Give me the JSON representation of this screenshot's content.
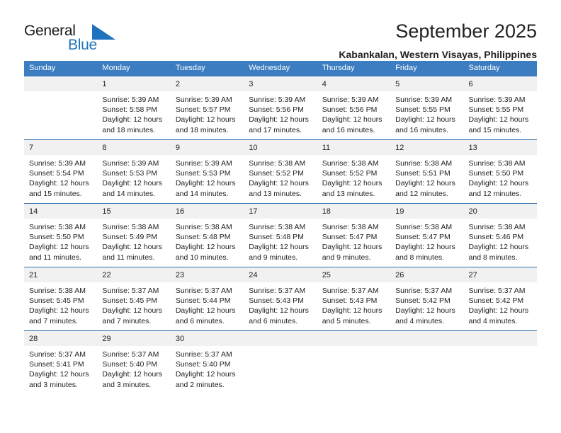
{
  "brand": {
    "name_part1": "General",
    "name_part2": "Blue",
    "flag_icon": "blue-triangle-flag-icon",
    "accent_color": "#1f72bd"
  },
  "header": {
    "title": "September 2025",
    "subtitle": "Kabankalan, Western Visayas, Philippines"
  },
  "theme": {
    "header_blue": "#3b7dc0",
    "daynum_band": "#f1f1f1",
    "separator": "#2f6fae"
  },
  "calendar": {
    "weekday_headers": [
      "Sunday",
      "Monday",
      "Tuesday",
      "Wednesday",
      "Thursday",
      "Friday",
      "Saturday"
    ],
    "weeks": [
      {
        "days": [
          {
            "num": "",
            "sunrise": "",
            "sunset": "",
            "daylight1": "",
            "daylight2": ""
          },
          {
            "num": "1",
            "sunrise": "Sunrise: 5:39 AM",
            "sunset": "Sunset: 5:58 PM",
            "daylight1": "Daylight: 12 hours",
            "daylight2": "and 18 minutes."
          },
          {
            "num": "2",
            "sunrise": "Sunrise: 5:39 AM",
            "sunset": "Sunset: 5:57 PM",
            "daylight1": "Daylight: 12 hours",
            "daylight2": "and 18 minutes."
          },
          {
            "num": "3",
            "sunrise": "Sunrise: 5:39 AM",
            "sunset": "Sunset: 5:56 PM",
            "daylight1": "Daylight: 12 hours",
            "daylight2": "and 17 minutes."
          },
          {
            "num": "4",
            "sunrise": "Sunrise: 5:39 AM",
            "sunset": "Sunset: 5:56 PM",
            "daylight1": "Daylight: 12 hours",
            "daylight2": "and 16 minutes."
          },
          {
            "num": "5",
            "sunrise": "Sunrise: 5:39 AM",
            "sunset": "Sunset: 5:55 PM",
            "daylight1": "Daylight: 12 hours",
            "daylight2": "and 16 minutes."
          },
          {
            "num": "6",
            "sunrise": "Sunrise: 5:39 AM",
            "sunset": "Sunset: 5:55 PM",
            "daylight1": "Daylight: 12 hours",
            "daylight2": "and 15 minutes."
          }
        ]
      },
      {
        "days": [
          {
            "num": "7",
            "sunrise": "Sunrise: 5:39 AM",
            "sunset": "Sunset: 5:54 PM",
            "daylight1": "Daylight: 12 hours",
            "daylight2": "and 15 minutes."
          },
          {
            "num": "8",
            "sunrise": "Sunrise: 5:39 AM",
            "sunset": "Sunset: 5:53 PM",
            "daylight1": "Daylight: 12 hours",
            "daylight2": "and 14 minutes."
          },
          {
            "num": "9",
            "sunrise": "Sunrise: 5:39 AM",
            "sunset": "Sunset: 5:53 PM",
            "daylight1": "Daylight: 12 hours",
            "daylight2": "and 14 minutes."
          },
          {
            "num": "10",
            "sunrise": "Sunrise: 5:38 AM",
            "sunset": "Sunset: 5:52 PM",
            "daylight1": "Daylight: 12 hours",
            "daylight2": "and 13 minutes."
          },
          {
            "num": "11",
            "sunrise": "Sunrise: 5:38 AM",
            "sunset": "Sunset: 5:52 PM",
            "daylight1": "Daylight: 12 hours",
            "daylight2": "and 13 minutes."
          },
          {
            "num": "12",
            "sunrise": "Sunrise: 5:38 AM",
            "sunset": "Sunset: 5:51 PM",
            "daylight1": "Daylight: 12 hours",
            "daylight2": "and 12 minutes."
          },
          {
            "num": "13",
            "sunrise": "Sunrise: 5:38 AM",
            "sunset": "Sunset: 5:50 PM",
            "daylight1": "Daylight: 12 hours",
            "daylight2": "and 12 minutes."
          }
        ]
      },
      {
        "days": [
          {
            "num": "14",
            "sunrise": "Sunrise: 5:38 AM",
            "sunset": "Sunset: 5:50 PM",
            "daylight1": "Daylight: 12 hours",
            "daylight2": "and 11 minutes."
          },
          {
            "num": "15",
            "sunrise": "Sunrise: 5:38 AM",
            "sunset": "Sunset: 5:49 PM",
            "daylight1": "Daylight: 12 hours",
            "daylight2": "and 11 minutes."
          },
          {
            "num": "16",
            "sunrise": "Sunrise: 5:38 AM",
            "sunset": "Sunset: 5:48 PM",
            "daylight1": "Daylight: 12 hours",
            "daylight2": "and 10 minutes."
          },
          {
            "num": "17",
            "sunrise": "Sunrise: 5:38 AM",
            "sunset": "Sunset: 5:48 PM",
            "daylight1": "Daylight: 12 hours",
            "daylight2": "and 9 minutes."
          },
          {
            "num": "18",
            "sunrise": "Sunrise: 5:38 AM",
            "sunset": "Sunset: 5:47 PM",
            "daylight1": "Daylight: 12 hours",
            "daylight2": "and 9 minutes."
          },
          {
            "num": "19",
            "sunrise": "Sunrise: 5:38 AM",
            "sunset": "Sunset: 5:47 PM",
            "daylight1": "Daylight: 12 hours",
            "daylight2": "and 8 minutes."
          },
          {
            "num": "20",
            "sunrise": "Sunrise: 5:38 AM",
            "sunset": "Sunset: 5:46 PM",
            "daylight1": "Daylight: 12 hours",
            "daylight2": "and 8 minutes."
          }
        ]
      },
      {
        "days": [
          {
            "num": "21",
            "sunrise": "Sunrise: 5:38 AM",
            "sunset": "Sunset: 5:45 PM",
            "daylight1": "Daylight: 12 hours",
            "daylight2": "and 7 minutes."
          },
          {
            "num": "22",
            "sunrise": "Sunrise: 5:37 AM",
            "sunset": "Sunset: 5:45 PM",
            "daylight1": "Daylight: 12 hours",
            "daylight2": "and 7 minutes."
          },
          {
            "num": "23",
            "sunrise": "Sunrise: 5:37 AM",
            "sunset": "Sunset: 5:44 PM",
            "daylight1": "Daylight: 12 hours",
            "daylight2": "and 6 minutes."
          },
          {
            "num": "24",
            "sunrise": "Sunrise: 5:37 AM",
            "sunset": "Sunset: 5:43 PM",
            "daylight1": "Daylight: 12 hours",
            "daylight2": "and 6 minutes."
          },
          {
            "num": "25",
            "sunrise": "Sunrise: 5:37 AM",
            "sunset": "Sunset: 5:43 PM",
            "daylight1": "Daylight: 12 hours",
            "daylight2": "and 5 minutes."
          },
          {
            "num": "26",
            "sunrise": "Sunrise: 5:37 AM",
            "sunset": "Sunset: 5:42 PM",
            "daylight1": "Daylight: 12 hours",
            "daylight2": "and 4 minutes."
          },
          {
            "num": "27",
            "sunrise": "Sunrise: 5:37 AM",
            "sunset": "Sunset: 5:42 PM",
            "daylight1": "Daylight: 12 hours",
            "daylight2": "and 4 minutes."
          }
        ]
      },
      {
        "days": [
          {
            "num": "28",
            "sunrise": "Sunrise: 5:37 AM",
            "sunset": "Sunset: 5:41 PM",
            "daylight1": "Daylight: 12 hours",
            "daylight2": "and 3 minutes."
          },
          {
            "num": "29",
            "sunrise": "Sunrise: 5:37 AM",
            "sunset": "Sunset: 5:40 PM",
            "daylight1": "Daylight: 12 hours",
            "daylight2": "and 3 minutes."
          },
          {
            "num": "30",
            "sunrise": "Sunrise: 5:37 AM",
            "sunset": "Sunset: 5:40 PM",
            "daylight1": "Daylight: 12 hours",
            "daylight2": "and 2 minutes."
          },
          {
            "num": "",
            "sunrise": "",
            "sunset": "",
            "daylight1": "",
            "daylight2": ""
          },
          {
            "num": "",
            "sunrise": "",
            "sunset": "",
            "daylight1": "",
            "daylight2": ""
          },
          {
            "num": "",
            "sunrise": "",
            "sunset": "",
            "daylight1": "",
            "daylight2": ""
          },
          {
            "num": "",
            "sunrise": "",
            "sunset": "",
            "daylight1": "",
            "daylight2": ""
          }
        ]
      }
    ]
  }
}
